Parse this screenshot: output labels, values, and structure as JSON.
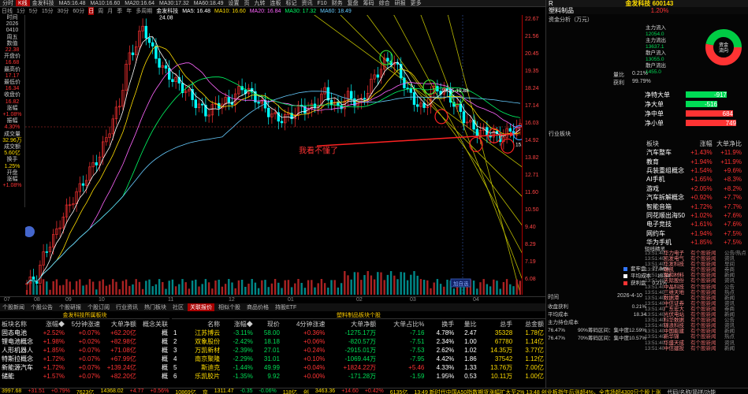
{
  "toolbar": {
    "items": [
      "分时",
      "K线",
      "金发科技",
      "MA5:16.48",
      "MA10:16.60",
      "MA20:16.64",
      "MA30:17.32",
      "MA60:18.49",
      "设置",
      "页",
      "九转",
      "连板",
      "标记",
      "资讯",
      "F10",
      "财务",
      "复盘",
      "筹码",
      "综合",
      "研报",
      "更多"
    ],
    "active": "K线"
  },
  "chart_bar": {
    "periods": [
      "日线",
      "1分",
      "5分",
      "15分",
      "30分",
      "60分",
      "日",
      "周",
      "月",
      "季",
      "年",
      "多周期"
    ],
    "active_period": "日",
    "stock": "金发科技",
    "ma": [
      {
        "label": "MA5: 16.48",
        "color": "#ffffff"
      },
      {
        "label": "MA10: 16.60",
        "color": "#ffdd00"
      },
      {
        "label": "MA20: 16.84",
        "color": "#ff66ff"
      },
      {
        "label": "MA30: 17.32",
        "color": "#00ff66"
      },
      {
        "label": "MA60: 18.49",
        "color": "#66ccff"
      }
    ]
  },
  "left_panel": [
    {
      "t": "时间",
      "c": "w"
    },
    {
      "t": "2026",
      "c": "w"
    },
    {
      "t": "0410",
      "c": "w"
    },
    {
      "t": "周五",
      "c": "w"
    },
    {
      "t": "数值",
      "c": "w"
    },
    {
      "t": "22.38",
      "c": "r"
    },
    {
      "t": "开盘价",
      "c": "w"
    },
    {
      "t": "16.68",
      "c": "r"
    },
    {
      "t": "最高价",
      "c": "w"
    },
    {
      "t": "17.17",
      "c": "r"
    },
    {
      "t": "最低价",
      "c": "w"
    },
    {
      "t": "16.34",
      "c": "r"
    },
    {
      "t": "收盘价",
      "c": "w"
    },
    {
      "t": "16.82",
      "c": "r"
    },
    {
      "t": "涨幅",
      "c": "w"
    },
    {
      "t": "+1.08%",
      "c": "r"
    },
    {
      "t": "振幅",
      "c": "w"
    },
    {
      "t": "4.30%",
      "c": "r"
    },
    {
      "t": "成交量",
      "c": "w"
    },
    {
      "t": "32.96万",
      "c": "y"
    },
    {
      "t": "成交额",
      "c": "w"
    },
    {
      "t": "5.60亿",
      "c": "y"
    },
    {
      "t": "换手",
      "c": "w"
    },
    {
      "t": "1.25%",
      "c": "y"
    },
    {
      "t": "开盘",
      "c": "w"
    },
    {
      "t": "涨幅",
      "c": "w"
    },
    {
      "t": "+1.08%",
      "c": "r"
    }
  ],
  "chart": {
    "price_labels": [
      "24.08",
      "21.56",
      "20.45",
      "19.35",
      "18.24",
      "16.03",
      "14.92",
      "13.82",
      "12.71",
      "11.60",
      "10.50",
      "9.40",
      "8.29"
    ],
    "high_label": "24.08",
    "annotation": "我看不懂了",
    "mid_label": "19.15-19.88",
    "low_label": "15.9",
    "cursor_label": "加自选"
  },
  "y_axis": [
    "22.67",
    "21.56",
    "20.45",
    "19.35",
    "18.24",
    "17.14",
    "16.03",
    "14.92",
    "13.82",
    "12.71",
    "11.60",
    "10.50",
    "9.40",
    "8.29",
    "7.19",
    "6.08"
  ],
  "x_axis": [
    "07",
    "08",
    "09",
    "10",
    "11",
    "12",
    "01",
    "02",
    "03",
    "04"
  ],
  "tabs": {
    "items": [
      "个股新闻",
      "个股公告",
      "个股研报",
      "个股订阅",
      "行业资讯",
      "热门板块",
      "社区",
      "关联报价",
      "相似个股",
      "商品价格",
      "持股ETF"
    ],
    "active": "关联报价"
  },
  "sector_table": {
    "title": "金发科技所属板块",
    "headers": [
      "板块名称",
      "涨幅◆",
      "5分钟涨速",
      "大单净额",
      "概念关联"
    ],
    "rows": [
      [
        "固态电池",
        "+2.52%",
        "+0.07%",
        "+62.20亿",
        "概"
      ],
      [
        "锂电池概念",
        "+1.98%",
        "+0.02%",
        "+82.98亿",
        "概"
      ],
      [
        "人形机器人",
        "+1.85%",
        "+0.07%",
        "+71.08亿",
        "概"
      ],
      [
        "特斯拉概念",
        "+1.72%",
        "+0.07%",
        "+67.99亿",
        "概"
      ],
      [
        "新能源汽车",
        "+1.72%",
        "+0.07%",
        "+139.24亿",
        "概"
      ],
      [
        "储能",
        "+1.57%",
        "+0.07%",
        "+82.20亿",
        "概"
      ]
    ]
  },
  "leader_table": {
    "title": "塑料制品板块个股",
    "headers": [
      "",
      "名称",
      "涨幅◆",
      "现价",
      "4分钟涨速",
      "大单净额",
      "大单占比%",
      "换手",
      "量比",
      "总手",
      "总金额"
    ],
    "rows": [
      [
        "1",
        "江苏博云",
        "-3.11%",
        "58.00",
        "+0.36%",
        "-1275.17万",
        "-7.16",
        "4.78%",
        "2.47",
        "35328",
        "1.78亿"
      ],
      [
        "2",
        "双象股份",
        "-2.42%",
        "18.18",
        "+0.06%",
        "-820.57万",
        "-7.51",
        "2.34%",
        "1.00",
        "67780",
        "1.14亿"
      ],
      [
        "3",
        "万凯新材",
        "-2.39%",
        "27.01",
        "+0.24%",
        "-2915.01万",
        "-7.53",
        "2.62%",
        "1.02",
        "14.35万",
        "3.77亿"
      ],
      [
        "4",
        "南京聚隆",
        "-2.29%",
        "31.01",
        "+0.10%",
        "-1069.44万",
        "-7.95",
        "4.42%",
        "1.86",
        "37542",
        "1.12亿"
      ],
      [
        "5",
        "斯迪克",
        "-1.44%",
        "49.99",
        "+0.04%",
        "+1824.22万",
        "+5.46",
        "4.33%",
        "1.33",
        "13.76万",
        "7.00亿"
      ],
      [
        "6",
        "乐凯胶片",
        "-1.35%",
        "9.92",
        "+0.00%",
        "-171.28万",
        "-1.59",
        "1.95%",
        "0.53",
        "10.11万",
        "1.00亿"
      ]
    ]
  },
  "status_bar": [
    "3997.68",
    "+31.51",
    "+0.79%",
    "7623亿",
    "14368.02",
    "+4.77",
    "+0.56%",
    "10869亿",
    "京",
    "1311.47",
    "-0.35",
    "-0.06%",
    "118亿",
    "创",
    "3463.36",
    "+14.60",
    "+0.42%",
    "6135亿"
  ],
  "ticker": "13:49 新时代中国A50指数期货涨幅扩大至2%   13:48 创业板指午后涨超4%，全市场超4300只个股上涨",
  "ticker_right": "代码/名称/简拼/功能",
  "right_panel": {
    "code_label": "R",
    "title": "金发科技 600143",
    "sector": "塑料制品",
    "sector_pct": "1.20%",
    "flow_title": "资金分析（万元）",
    "donut_center": "资金流向",
    "flow_items": [
      {
        "label": "主力流入",
        "value": "12054.0"
      },
      {
        "label": "主力流出",
        "value": "13637.1"
      },
      {
        "label": "散户流入",
        "value": "13055.0"
      },
      {
        "label": "散户流出",
        "value": "1455.0"
      }
    ],
    "extra_rows": [
      {
        "k": "量比",
        "v": "0.21%"
      },
      {
        "k": "获利",
        "v": "99.79%"
      }
    ],
    "net_rows": [
      {
        "label": "净特大单",
        "value": "-917",
        "color": "#00dd55"
      },
      {
        "label": "净大单",
        "value": "-516",
        "color": "#00dd55"
      },
      {
        "label": "净中单",
        "value": "684",
        "color": "#ff3333"
      },
      {
        "label": "净小单",
        "value": "749",
        "color": "#ff3333"
      }
    ],
    "ind_title": "行业板块",
    "ind_headers": [
      "板块",
      "涨幅",
      "大单净比"
    ],
    "ind_rows": [
      [
        "汽车整车",
        "+1.43%",
        "+11.9%"
      ],
      [
        "教育",
        "+1.94%",
        "+11.9%"
      ],
      [
        "兵装重组概念",
        "+1.54%",
        "+9.6%"
      ],
      [
        "AI手机",
        "+1.65%",
        "+8.3%"
      ],
      [
        "游戏",
        "+2.05%",
        "+8.2%"
      ],
      [
        "汽车拆解概念",
        "+0.92%",
        "+7.7%"
      ],
      [
        "智能音箱",
        "+1.72%",
        "+7.7%"
      ],
      [
        "同花顺出海50",
        "+1.02%",
        "+7.6%"
      ],
      [
        "电子竞技",
        "+1.61%",
        "+7.6%"
      ],
      [
        "网约车",
        "+1.94%",
        "+7.5%"
      ],
      [
        "华为手机",
        "+1.85%",
        "+7.5%"
      ]
    ],
    "chip_title": "筹码分布",
    "chip_rows": [
      {
        "k": "套牢盘",
        "v": "77.04%"
      },
      {
        "k": "平均成本",
        "v": "18.34"
      },
      {
        "k": "获利盘",
        "v": "0.21%"
      }
    ],
    "chip_date": "2026-4-10",
    "chip_detail": [
      {
        "k": "收盘获利",
        "v": "0.21%"
      },
      {
        "k": "平均成本",
        "v": "18.34"
      },
      {
        "k": "主力持仓成本",
        "v": ""
      },
      {
        "k": "76.47%",
        "v": "90%筹码区间：集中度12.59%"
      },
      {
        "k": "76.47%",
        "v": "70%筹码区间：集中度10.57%"
      }
    ],
    "log_title": "短线精灵",
    "log": [
      [
        "13:51:40",
        "华力电子",
        "有个股新闻"
      ],
      [
        "13:51:40",
        "凯发电气",
        "有个股新闻"
      ],
      [
        "13:51:40",
        "华发科技",
        "有个股新闻"
      ],
      [
        "13:51:40",
        "瑞凯",
        "有个股新闻"
      ],
      [
        "13:51:40",
        "聚和材料",
        "有个股新闻"
      ],
      [
        "13:51:40",
        "天际股份",
        "有个股新闻"
      ],
      [
        "13:51:40",
        "中晶科技",
        "有个股新闻"
      ],
      [
        "13:51:40",
        "三维天地",
        "有个股新闻"
      ],
      [
        "13:51:40",
        "数据港",
        "有个股新闻"
      ],
      [
        "13:51:40",
        "中信证券",
        "有个股新闻"
      ],
      [
        "13:51:40",
        "广东宏大",
        "有个股新闻"
      ],
      [
        "13:51:40",
        "光伏电站",
        "有个股新闻"
      ],
      [
        "13:51:40",
        "科华数据",
        "有个股新闻"
      ],
      [
        "13:51:40",
        "锦浪科技",
        "有个股新闻"
      ],
      [
        "13:51:40",
        "中国能建",
        "有个股新闻"
      ],
      [
        "13:51:40",
        "新华锦",
        "有个股新闻"
      ],
      [
        "13:51:40",
        "华盛天成",
        "有个股新闻"
      ],
      [
        "13:51:40",
        "中信建投",
        "有个股新闻"
      ]
    ],
    "log_right": [
      "公告/热点",
      "资讯",
      "早间",
      "券商",
      "新闻",
      "资讯",
      "公告",
      "热点",
      "新闻",
      "资讯",
      "券商",
      "新闻",
      "公告",
      "资讯",
      "新闻",
      "热点",
      "资讯",
      "新闻"
    ]
  }
}
